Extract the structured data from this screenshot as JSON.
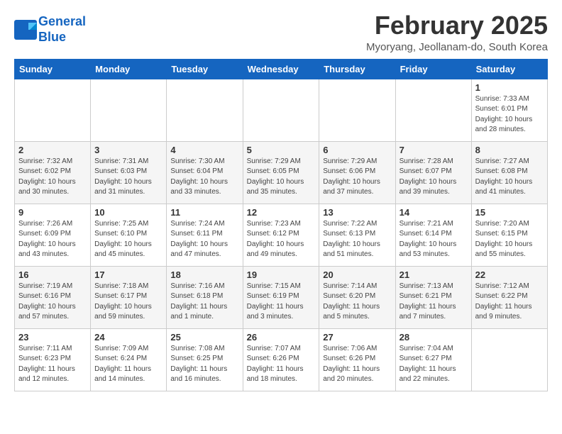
{
  "header": {
    "logo_line1": "General",
    "logo_line2": "Blue",
    "title": "February 2025",
    "subtitle": "Myoryang, Jeollanam-do, South Korea"
  },
  "weekdays": [
    "Sunday",
    "Monday",
    "Tuesday",
    "Wednesday",
    "Thursday",
    "Friday",
    "Saturday"
  ],
  "weeks": [
    [
      {
        "day": "",
        "info": ""
      },
      {
        "day": "",
        "info": ""
      },
      {
        "day": "",
        "info": ""
      },
      {
        "day": "",
        "info": ""
      },
      {
        "day": "",
        "info": ""
      },
      {
        "day": "",
        "info": ""
      },
      {
        "day": "1",
        "info": "Sunrise: 7:33 AM\nSunset: 6:01 PM\nDaylight: 10 hours\nand 28 minutes."
      }
    ],
    [
      {
        "day": "2",
        "info": "Sunrise: 7:32 AM\nSunset: 6:02 PM\nDaylight: 10 hours\nand 30 minutes."
      },
      {
        "day": "3",
        "info": "Sunrise: 7:31 AM\nSunset: 6:03 PM\nDaylight: 10 hours\nand 31 minutes."
      },
      {
        "day": "4",
        "info": "Sunrise: 7:30 AM\nSunset: 6:04 PM\nDaylight: 10 hours\nand 33 minutes."
      },
      {
        "day": "5",
        "info": "Sunrise: 7:29 AM\nSunset: 6:05 PM\nDaylight: 10 hours\nand 35 minutes."
      },
      {
        "day": "6",
        "info": "Sunrise: 7:29 AM\nSunset: 6:06 PM\nDaylight: 10 hours\nand 37 minutes."
      },
      {
        "day": "7",
        "info": "Sunrise: 7:28 AM\nSunset: 6:07 PM\nDaylight: 10 hours\nand 39 minutes."
      },
      {
        "day": "8",
        "info": "Sunrise: 7:27 AM\nSunset: 6:08 PM\nDaylight: 10 hours\nand 41 minutes."
      }
    ],
    [
      {
        "day": "9",
        "info": "Sunrise: 7:26 AM\nSunset: 6:09 PM\nDaylight: 10 hours\nand 43 minutes."
      },
      {
        "day": "10",
        "info": "Sunrise: 7:25 AM\nSunset: 6:10 PM\nDaylight: 10 hours\nand 45 minutes."
      },
      {
        "day": "11",
        "info": "Sunrise: 7:24 AM\nSunset: 6:11 PM\nDaylight: 10 hours\nand 47 minutes."
      },
      {
        "day": "12",
        "info": "Sunrise: 7:23 AM\nSunset: 6:12 PM\nDaylight: 10 hours\nand 49 minutes."
      },
      {
        "day": "13",
        "info": "Sunrise: 7:22 AM\nSunset: 6:13 PM\nDaylight: 10 hours\nand 51 minutes."
      },
      {
        "day": "14",
        "info": "Sunrise: 7:21 AM\nSunset: 6:14 PM\nDaylight: 10 hours\nand 53 minutes."
      },
      {
        "day": "15",
        "info": "Sunrise: 7:20 AM\nSunset: 6:15 PM\nDaylight: 10 hours\nand 55 minutes."
      }
    ],
    [
      {
        "day": "16",
        "info": "Sunrise: 7:19 AM\nSunset: 6:16 PM\nDaylight: 10 hours\nand 57 minutes."
      },
      {
        "day": "17",
        "info": "Sunrise: 7:18 AM\nSunset: 6:17 PM\nDaylight: 10 hours\nand 59 minutes."
      },
      {
        "day": "18",
        "info": "Sunrise: 7:16 AM\nSunset: 6:18 PM\nDaylight: 11 hours\nand 1 minute."
      },
      {
        "day": "19",
        "info": "Sunrise: 7:15 AM\nSunset: 6:19 PM\nDaylight: 11 hours\nand 3 minutes."
      },
      {
        "day": "20",
        "info": "Sunrise: 7:14 AM\nSunset: 6:20 PM\nDaylight: 11 hours\nand 5 minutes."
      },
      {
        "day": "21",
        "info": "Sunrise: 7:13 AM\nSunset: 6:21 PM\nDaylight: 11 hours\nand 7 minutes."
      },
      {
        "day": "22",
        "info": "Sunrise: 7:12 AM\nSunset: 6:22 PM\nDaylight: 11 hours\nand 9 minutes."
      }
    ],
    [
      {
        "day": "23",
        "info": "Sunrise: 7:11 AM\nSunset: 6:23 PM\nDaylight: 11 hours\nand 12 minutes."
      },
      {
        "day": "24",
        "info": "Sunrise: 7:09 AM\nSunset: 6:24 PM\nDaylight: 11 hours\nand 14 minutes."
      },
      {
        "day": "25",
        "info": "Sunrise: 7:08 AM\nSunset: 6:25 PM\nDaylight: 11 hours\nand 16 minutes."
      },
      {
        "day": "26",
        "info": "Sunrise: 7:07 AM\nSunset: 6:26 PM\nDaylight: 11 hours\nand 18 minutes."
      },
      {
        "day": "27",
        "info": "Sunrise: 7:06 AM\nSunset: 6:26 PM\nDaylight: 11 hours\nand 20 minutes."
      },
      {
        "day": "28",
        "info": "Sunrise: 7:04 AM\nSunset: 6:27 PM\nDaylight: 11 hours\nand 22 minutes."
      },
      {
        "day": "",
        "info": ""
      }
    ]
  ]
}
